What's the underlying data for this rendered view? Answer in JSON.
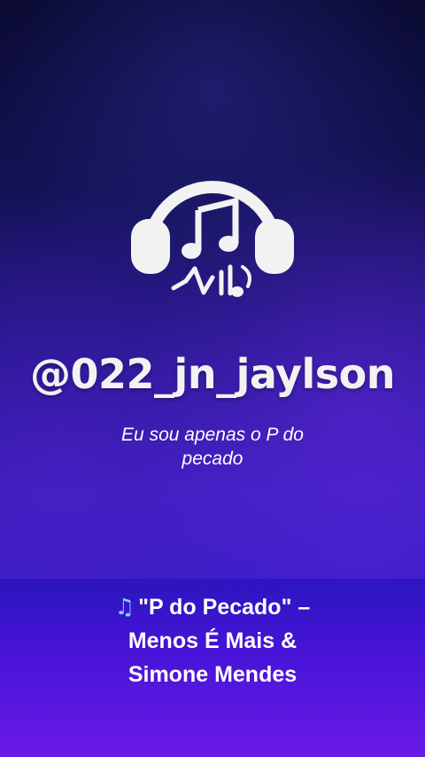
{
  "profile": {
    "handle": "@022_jn_jaylson",
    "bio": "Eu sou apenas o P do pecado"
  },
  "caption": {
    "icon": "musical-notes-icon",
    "line1": "\"P do Pecado\" –",
    "line2": "Menos É Mais &",
    "line3": "Simone Mendes"
  },
  "colors": {
    "background_top": "#0b0b34",
    "background_bottom": "#3a1ad0",
    "caption_band": "#5a18e0",
    "logo": "#f2f2f2"
  }
}
